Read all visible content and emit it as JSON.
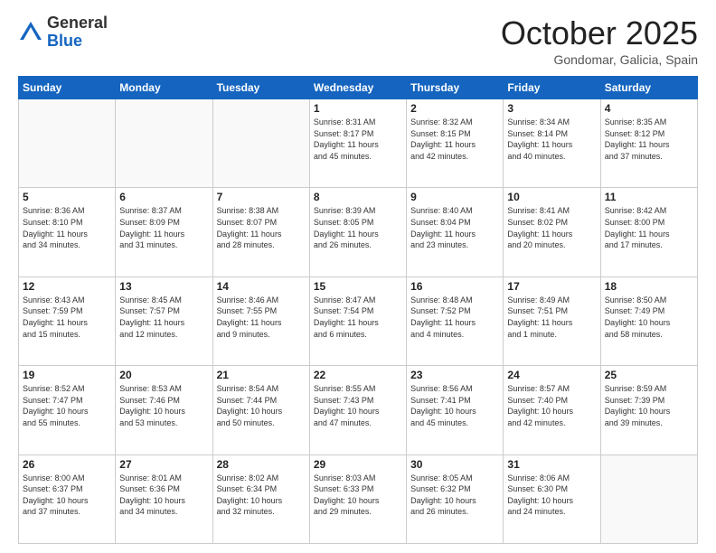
{
  "header": {
    "logo_general": "General",
    "logo_blue": "Blue",
    "month_title": "October 2025",
    "location": "Gondomar, Galicia, Spain"
  },
  "weekdays": [
    "Sunday",
    "Monday",
    "Tuesday",
    "Wednesday",
    "Thursday",
    "Friday",
    "Saturday"
  ],
  "weeks": [
    [
      {
        "day": "",
        "info": ""
      },
      {
        "day": "",
        "info": ""
      },
      {
        "day": "",
        "info": ""
      },
      {
        "day": "1",
        "info": "Sunrise: 8:31 AM\nSunset: 8:17 PM\nDaylight: 11 hours\nand 45 minutes."
      },
      {
        "day": "2",
        "info": "Sunrise: 8:32 AM\nSunset: 8:15 PM\nDaylight: 11 hours\nand 42 minutes."
      },
      {
        "day": "3",
        "info": "Sunrise: 8:34 AM\nSunset: 8:14 PM\nDaylight: 11 hours\nand 40 minutes."
      },
      {
        "day": "4",
        "info": "Sunrise: 8:35 AM\nSunset: 8:12 PM\nDaylight: 11 hours\nand 37 minutes."
      }
    ],
    [
      {
        "day": "5",
        "info": "Sunrise: 8:36 AM\nSunset: 8:10 PM\nDaylight: 11 hours\nand 34 minutes."
      },
      {
        "day": "6",
        "info": "Sunrise: 8:37 AM\nSunset: 8:09 PM\nDaylight: 11 hours\nand 31 minutes."
      },
      {
        "day": "7",
        "info": "Sunrise: 8:38 AM\nSunset: 8:07 PM\nDaylight: 11 hours\nand 28 minutes."
      },
      {
        "day": "8",
        "info": "Sunrise: 8:39 AM\nSunset: 8:05 PM\nDaylight: 11 hours\nand 26 minutes."
      },
      {
        "day": "9",
        "info": "Sunrise: 8:40 AM\nSunset: 8:04 PM\nDaylight: 11 hours\nand 23 minutes."
      },
      {
        "day": "10",
        "info": "Sunrise: 8:41 AM\nSunset: 8:02 PM\nDaylight: 11 hours\nand 20 minutes."
      },
      {
        "day": "11",
        "info": "Sunrise: 8:42 AM\nSunset: 8:00 PM\nDaylight: 11 hours\nand 17 minutes."
      }
    ],
    [
      {
        "day": "12",
        "info": "Sunrise: 8:43 AM\nSunset: 7:59 PM\nDaylight: 11 hours\nand 15 minutes."
      },
      {
        "day": "13",
        "info": "Sunrise: 8:45 AM\nSunset: 7:57 PM\nDaylight: 11 hours\nand 12 minutes."
      },
      {
        "day": "14",
        "info": "Sunrise: 8:46 AM\nSunset: 7:55 PM\nDaylight: 11 hours\nand 9 minutes."
      },
      {
        "day": "15",
        "info": "Sunrise: 8:47 AM\nSunset: 7:54 PM\nDaylight: 11 hours\nand 6 minutes."
      },
      {
        "day": "16",
        "info": "Sunrise: 8:48 AM\nSunset: 7:52 PM\nDaylight: 11 hours\nand 4 minutes."
      },
      {
        "day": "17",
        "info": "Sunrise: 8:49 AM\nSunset: 7:51 PM\nDaylight: 11 hours\nand 1 minute."
      },
      {
        "day": "18",
        "info": "Sunrise: 8:50 AM\nSunset: 7:49 PM\nDaylight: 10 hours\nand 58 minutes."
      }
    ],
    [
      {
        "day": "19",
        "info": "Sunrise: 8:52 AM\nSunset: 7:47 PM\nDaylight: 10 hours\nand 55 minutes."
      },
      {
        "day": "20",
        "info": "Sunrise: 8:53 AM\nSunset: 7:46 PM\nDaylight: 10 hours\nand 53 minutes."
      },
      {
        "day": "21",
        "info": "Sunrise: 8:54 AM\nSunset: 7:44 PM\nDaylight: 10 hours\nand 50 minutes."
      },
      {
        "day": "22",
        "info": "Sunrise: 8:55 AM\nSunset: 7:43 PM\nDaylight: 10 hours\nand 47 minutes."
      },
      {
        "day": "23",
        "info": "Sunrise: 8:56 AM\nSunset: 7:41 PM\nDaylight: 10 hours\nand 45 minutes."
      },
      {
        "day": "24",
        "info": "Sunrise: 8:57 AM\nSunset: 7:40 PM\nDaylight: 10 hours\nand 42 minutes."
      },
      {
        "day": "25",
        "info": "Sunrise: 8:59 AM\nSunset: 7:39 PM\nDaylight: 10 hours\nand 39 minutes."
      }
    ],
    [
      {
        "day": "26",
        "info": "Sunrise: 8:00 AM\nSunset: 6:37 PM\nDaylight: 10 hours\nand 37 minutes."
      },
      {
        "day": "27",
        "info": "Sunrise: 8:01 AM\nSunset: 6:36 PM\nDaylight: 10 hours\nand 34 minutes."
      },
      {
        "day": "28",
        "info": "Sunrise: 8:02 AM\nSunset: 6:34 PM\nDaylight: 10 hours\nand 32 minutes."
      },
      {
        "day": "29",
        "info": "Sunrise: 8:03 AM\nSunset: 6:33 PM\nDaylight: 10 hours\nand 29 minutes."
      },
      {
        "day": "30",
        "info": "Sunrise: 8:05 AM\nSunset: 6:32 PM\nDaylight: 10 hours\nand 26 minutes."
      },
      {
        "day": "31",
        "info": "Sunrise: 8:06 AM\nSunset: 6:30 PM\nDaylight: 10 hours\nand 24 minutes."
      },
      {
        "day": "",
        "info": ""
      }
    ]
  ]
}
